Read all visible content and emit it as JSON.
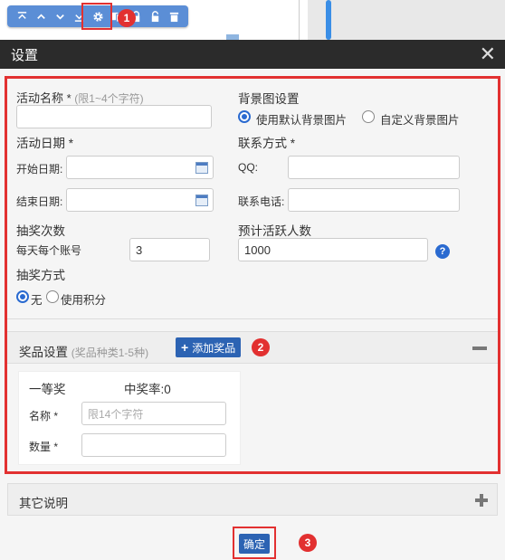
{
  "toolbar": {
    "buttons": [
      "top",
      "up",
      "down",
      "bottom",
      "settings",
      "copy",
      "lock",
      "unlock",
      "delete"
    ]
  },
  "callouts": [
    "1",
    "2",
    "3"
  ],
  "dialog": {
    "title": "设置",
    "close": "✕"
  },
  "form": {
    "activity_name_label": "活动名称 *",
    "activity_name_hint": "(限1~4个字符)",
    "activity_name_value": "",
    "bg_label": "背景图设置",
    "bg_default": "使用默认背景图片",
    "bg_custom": "自定义背景图片",
    "date_label": "活动日期 *",
    "start_label": "开始日期:",
    "end_label": "结束日期:",
    "contact_label": "联系方式 *",
    "qq_label": "QQ:",
    "phone_label": "联系电话:",
    "draw_count_label": "抽奖次数",
    "per_day_label": "每天每个账号",
    "per_day_value": "3",
    "expected_users_label": "预计活跃人数",
    "expected_users_value": "1000",
    "help": "?",
    "draw_method_label": "抽奖方式",
    "method_none": "无",
    "method_points": "使用积分"
  },
  "prizes": {
    "header": "奖品设置",
    "hint": "(奖品种类1-5种)",
    "add_button": "添加奖品",
    "add_icon": "+",
    "items": [
      {
        "level": "一等奖",
        "rate": "中奖率:0",
        "name_label": "名称 *",
        "name_placeholder": "限14个字符",
        "qty_label": "数量 *"
      }
    ]
  },
  "other": {
    "header": "其它说明"
  },
  "confirm_button": "确定",
  "colors": {
    "titlebar": "#2b2b2b",
    "primary": "#2c63b3",
    "toolbar": "#5b8ed6",
    "highlight": "#e23030"
  }
}
